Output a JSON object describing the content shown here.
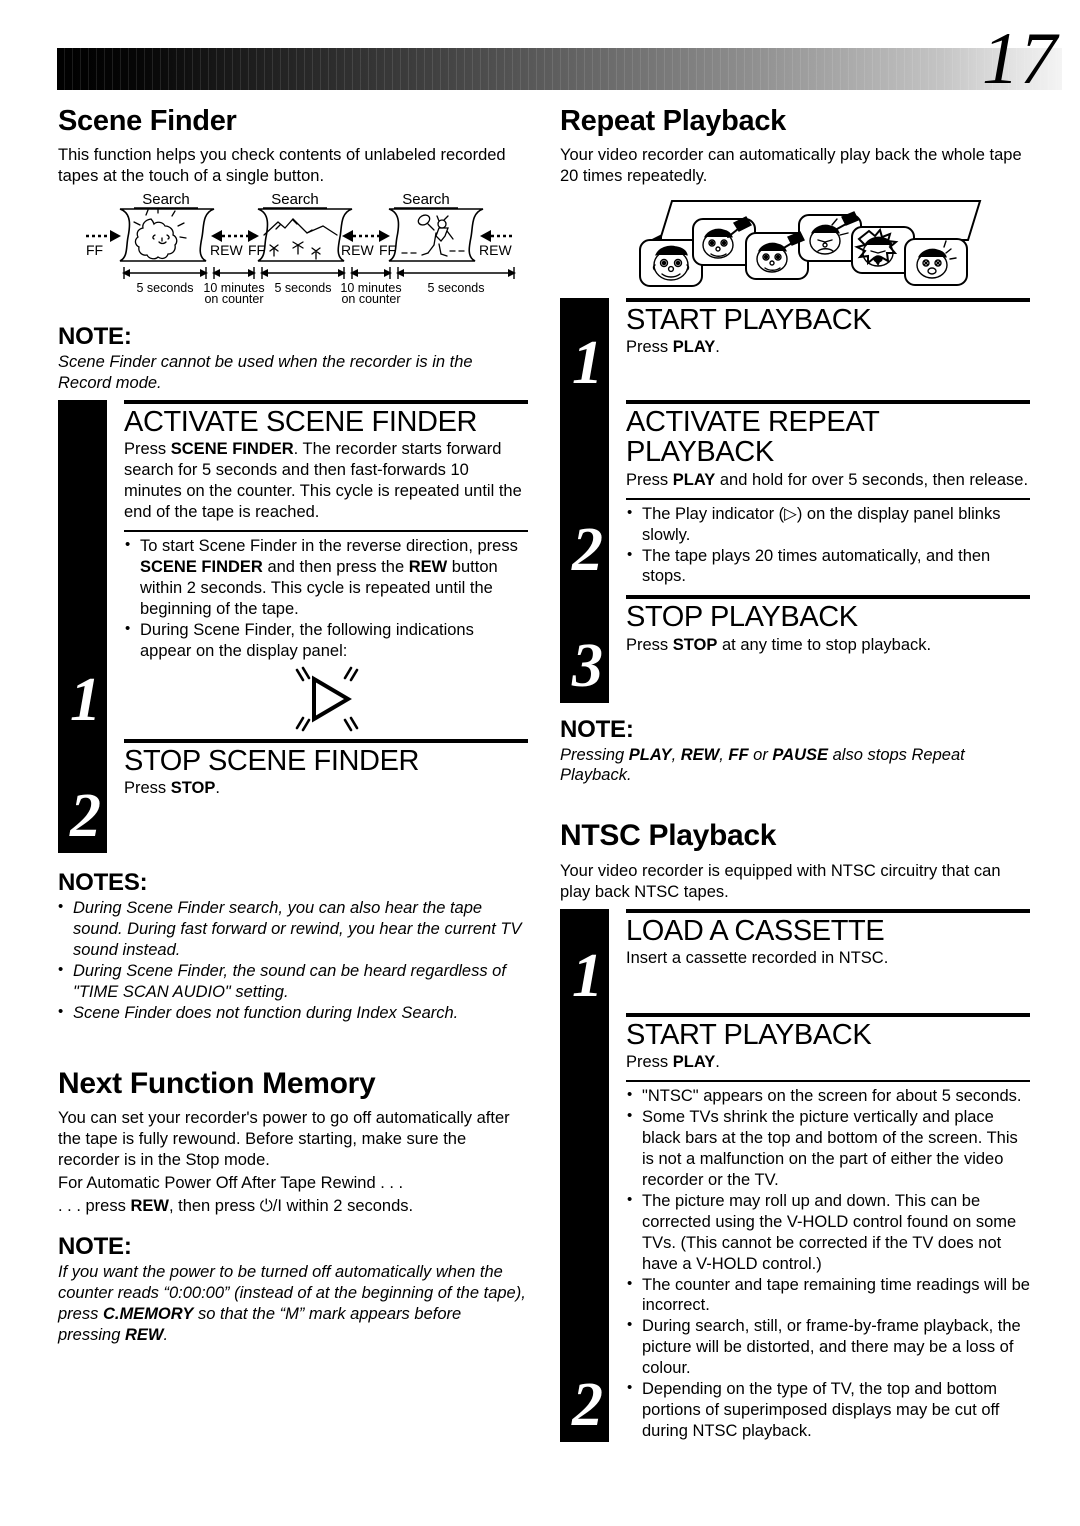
{
  "page": {
    "number": "17"
  },
  "left": {
    "scene_finder": {
      "title": "Scene Finder",
      "intro": "This function helps you check contents of unlabeled recorded tapes at the touch of a single button.",
      "diagram": {
        "search_labels": [
          "Search",
          "Search",
          "Search"
        ],
        "transport_labels": [
          "FF",
          "REW",
          "FF",
          "REW",
          "FF",
          "REW"
        ],
        "scale_labels": [
          "5 seconds",
          "10 minutes on counter",
          "5 seconds",
          "10 minutes on counter",
          "5 seconds"
        ],
        "scene_icons": [
          "lion-icon",
          "mountain-icon",
          "tennis-player-icon"
        ]
      },
      "note_heading": "NOTE:",
      "note_text": "Scene Finder cannot be used when the recorder is in the Record mode.",
      "steps": [
        {
          "number": "1",
          "title": "ACTIVATE SCENE FINDER",
          "text_parts": [
            {
              "t": "Press ",
              "b": false
            },
            {
              "t": "SCENE FINDER",
              "b": true
            },
            {
              "t": ". The recorder starts forward search for 5 seconds and then fast-forwards 10 minutes on the counter. This cycle is repeated until the end of the tape is reached.",
              "b": false
            }
          ],
          "bullets": [
            [
              {
                "t": "To start Scene Finder in the reverse direction, press ",
                "b": false
              },
              {
                "t": "SCENE FINDER",
                "b": true
              },
              {
                "t": " and then press the ",
                "b": false
              },
              {
                "t": "REW",
                "b": true
              },
              {
                "t": " button within 2 seconds. This cycle is repeated until the beginning of the tape.",
                "b": false
              }
            ],
            [
              {
                "t": "During Scene Finder, the following indications appear on the display panel:",
                "b": false
              }
            ]
          ],
          "indicator": "blinking-play-triangle-icon"
        },
        {
          "number": "2",
          "title": "STOP SCENE FINDER",
          "text_parts": [
            {
              "t": "Press ",
              "b": false
            },
            {
              "t": "STOP",
              "b": true
            },
            {
              "t": ".",
              "b": false
            }
          ]
        }
      ],
      "notes_heading": "NOTES:",
      "notes_list": [
        "During Scene Finder search, you can also hear the tape sound. During fast forward or rewind, you hear the current TV sound instead.",
        "During Scene Finder, the sound can be heard regardless of \"TIME SCAN AUDIO\" setting.",
        "Scene Finder does not function during Index Search."
      ]
    },
    "next_function_memory": {
      "title": "Next Function Memory",
      "paragraphs": [
        "You can set your recorder's power to go off automatically after the tape is fully rewound. Before starting, make sure the recorder is in the Stop mode.",
        "For Automatic Power Off After Tape Rewind . . ."
      ],
      "instruction_parts": [
        {
          "t": ". . . press ",
          "b": false
        },
        {
          "t": "REW",
          "b": true
        },
        {
          "t": ", then press ⏻/I within 2 seconds.",
          "b": false
        }
      ],
      "note_heading": "NOTE:",
      "note_parts": [
        {
          "t": "If you want the power to be turned off automatically when the counter reads “0:00:00” (instead of at the beginning of the tape), press ",
          "b": false
        },
        {
          "t": "C.MEMORY",
          "b": true
        },
        {
          "t": " so that the “M” mark appears before pressing ",
          "b": false
        },
        {
          "t": "REW",
          "b": true
        },
        {
          "t": ".",
          "b": false
        }
      ]
    }
  },
  "right": {
    "repeat_playback": {
      "title": "Repeat Playback",
      "intro": "Your video recorder can automatically play back the whole tape 20 times repeatedly.",
      "illustration": "repeating-tape-frames-icon",
      "steps": [
        {
          "number": "1",
          "title": "START PLAYBACK",
          "text_parts": [
            {
              "t": "Press ",
              "b": false
            },
            {
              "t": "PLAY",
              "b": true
            },
            {
              "t": ".",
              "b": false
            }
          ]
        },
        {
          "number": "2",
          "title": "ACTIVATE REPEAT PLAYBACK",
          "text_parts": [
            {
              "t": "Press ",
              "b": false
            },
            {
              "t": "PLAY",
              "b": true
            },
            {
              "t": " and hold for over 5 seconds, then release.",
              "b": false
            }
          ],
          "bullets": [
            [
              {
                "t": "The Play indicator (▷) on the display panel blinks slowly.",
                "b": false
              }
            ],
            [
              {
                "t": "The tape plays 20 times automatically, and then stops.",
                "b": false
              }
            ]
          ]
        },
        {
          "number": "3",
          "title": "STOP PLAYBACK",
          "text_parts": [
            {
              "t": "Press ",
              "b": false
            },
            {
              "t": "STOP",
              "b": true
            },
            {
              "t": " at any time to stop playback.",
              "b": false
            }
          ]
        }
      ],
      "note_heading": "NOTE:",
      "note_parts": [
        {
          "t": "Pressing ",
          "b": false
        },
        {
          "t": "PLAY",
          "b": true
        },
        {
          "t": ", ",
          "b": false
        },
        {
          "t": "REW",
          "b": true
        },
        {
          "t": ", ",
          "b": false
        },
        {
          "t": "FF",
          "b": true
        },
        {
          "t": " or ",
          "b": false
        },
        {
          "t": "PAUSE",
          "b": true
        },
        {
          "t": " also stops Repeat Playback.",
          "b": false
        }
      ]
    },
    "ntsc_playback": {
      "title": "NTSC Playback",
      "intro": "Your video recorder is equipped with NTSC circuitry that can play back NTSC tapes.",
      "steps": [
        {
          "number": "1",
          "title": "LOAD A CASSETTE",
          "text_parts": [
            {
              "t": "Insert a cassette recorded in NTSC.",
              "b": false
            }
          ]
        },
        {
          "number": "2",
          "title": "START PLAYBACK",
          "text_parts": [
            {
              "t": "Press ",
              "b": false
            },
            {
              "t": "PLAY",
              "b": true
            },
            {
              "t": ".",
              "b": false
            }
          ],
          "bullets": [
            [
              {
                "t": "\"NTSC\" appears on the screen for about 5 seconds.",
                "b": false
              }
            ],
            [
              {
                "t": "Some TVs shrink the picture vertically and place black bars at the top and bottom of the screen. This is not a malfunction on the part of either the video recorder or the TV.",
                "b": false
              }
            ],
            [
              {
                "t": "The picture may roll up and down. This can be corrected using the V-HOLD control found on some TVs. (This cannot be corrected if the TV does not have a V-HOLD control.)",
                "b": false
              }
            ],
            [
              {
                "t": "The counter and tape remaining time readings will be incorrect.",
                "b": false
              }
            ],
            [
              {
                "t": "During search, still, or frame-by-frame playback, the picture will be distorted, and there may be a loss of colour.",
                "b": false
              }
            ],
            [
              {
                "t": "Depending on the type of TV, the top and bottom portions of superimposed displays may be cut off during NTSC playback.",
                "b": false
              }
            ]
          ]
        }
      ]
    }
  }
}
